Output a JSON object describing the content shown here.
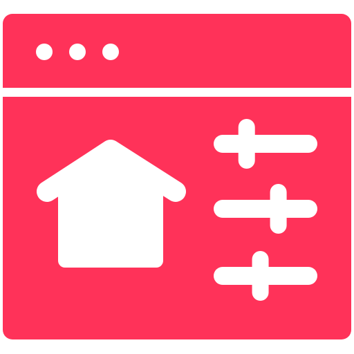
{
  "icon": {
    "name": "smart-home-settings-window-icon",
    "accent_color": "#ff3259",
    "foreground_color": "#ffffff",
    "window_dots": 3,
    "slider_knob_levels": [
      0.28,
      0.65,
      0.44
    ]
  }
}
